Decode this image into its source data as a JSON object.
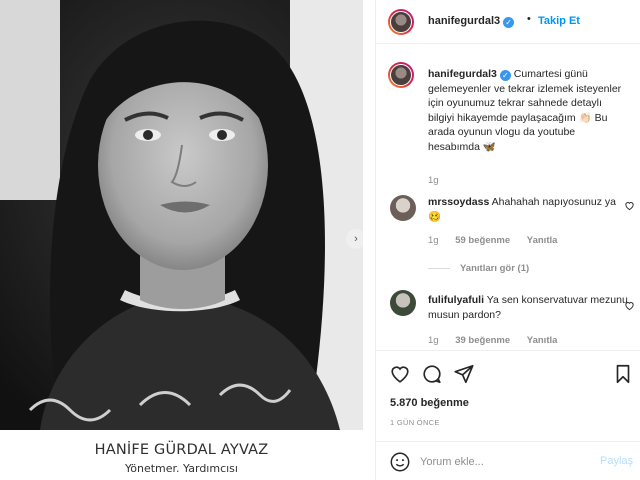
{
  "header": {
    "username": "hanifegurdal3",
    "follow_label": "Takip Et",
    "separator": "•"
  },
  "media": {
    "caption_name": "HANİFE GÜRDAL AYVAZ",
    "caption_role": "Yönetmer. Yardımcısı",
    "next_glyph": "›"
  },
  "caption": {
    "username": "hanifegurdal3",
    "text": "Cumartesi günü gelemeyenler ve tekrar izlemek isteyenler için oyunumuz tekrar sahnede detaylı bilgiyi hikayemde paylaşacağım 👏🏻 Bu arada oyunun vlogu da youtube hesabımda 🦋",
    "age": "1g"
  },
  "comments": [
    {
      "username": "mrssoydass",
      "text": "Ahahahah napıyosunuz ya🥴",
      "age": "1g",
      "likes": "59 beğenme",
      "reply_label": "Yanıtla",
      "view_replies": "Yanıtları gör (1)"
    },
    {
      "username": "fulifulyafuli",
      "text": "Ya sen konservatuvar mezunu musun pardon?",
      "age": "1g",
      "likes": "39 beğenme",
      "reply_label": "Yanıtla"
    }
  ],
  "footer": {
    "likes_count": "5.870 beğenme",
    "time_ago": "1 GÜN ÖNCE",
    "comment_placeholder": "Yorum ekle...",
    "post_label": "Paylaş"
  },
  "colors": {
    "accent": "#0095f6",
    "verified": "#3897f0",
    "muted": "#8e8e8e"
  }
}
